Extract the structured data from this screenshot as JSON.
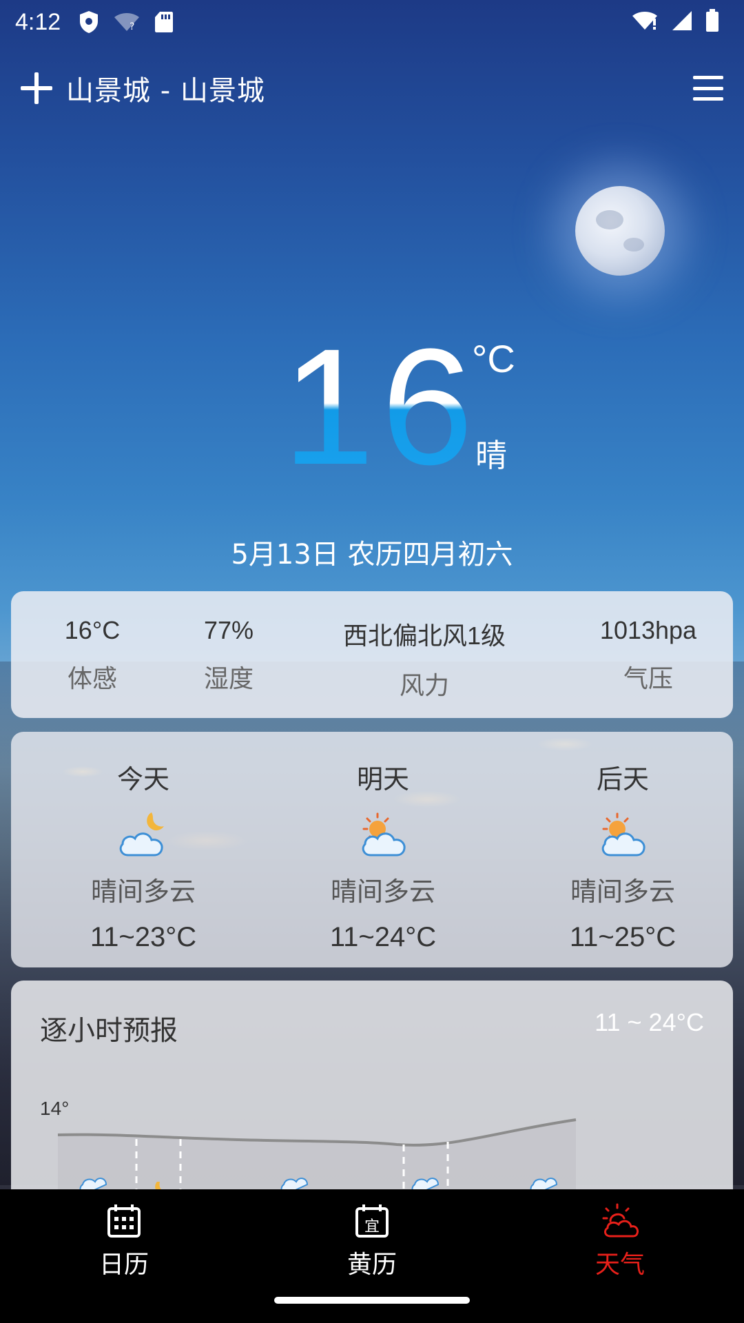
{
  "status_bar": {
    "time": "4:12"
  },
  "header": {
    "location": "山景城 - 山景城"
  },
  "current": {
    "temperature": "16",
    "unit": "°C",
    "condition": "晴",
    "date": "5月13日 农历四月初六"
  },
  "details": [
    {
      "value": "16°C",
      "label": "体感"
    },
    {
      "value": "77%",
      "label": "湿度"
    },
    {
      "value": "西北偏北风1级",
      "label": "风力"
    },
    {
      "value": "1013hpa",
      "label": "气压"
    }
  ],
  "forecast": [
    {
      "day": "今天",
      "condition": "晴间多云",
      "range": "11~23°C",
      "icon": "partly-cloudy-night-icon"
    },
    {
      "day": "明天",
      "condition": "晴间多云",
      "range": "11~24°C",
      "icon": "partly-cloudy-day-icon"
    },
    {
      "day": "后天",
      "condition": "晴间多云",
      "range": "11~25°C",
      "icon": "partly-cloudy-day-icon"
    }
  ],
  "hourly": {
    "title": "逐小时预报",
    "range": "11 ~ 24°C",
    "first_label": "14°"
  },
  "nav": {
    "calendar": "日历",
    "almanac": "黄历",
    "almanac_icon_char": "宜",
    "weather": "天气",
    "active_color": "#e8201a"
  }
}
